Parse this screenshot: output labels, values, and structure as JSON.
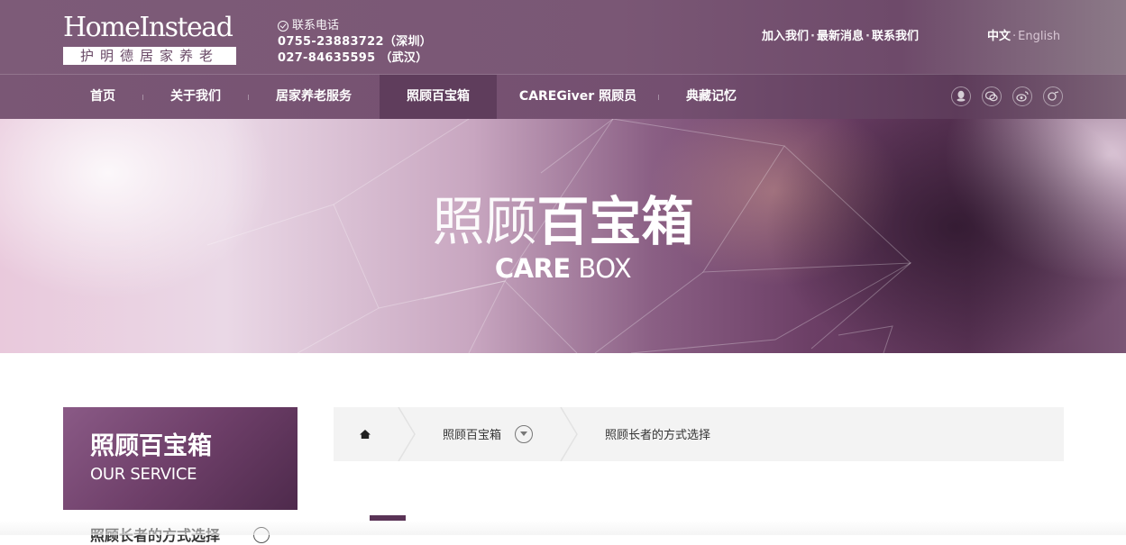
{
  "logo": {
    "main": "HomeInstead",
    "sub": "护明德居家养老"
  },
  "contact": {
    "label": "联系电话",
    "phones": [
      "0755-23883722（深圳）",
      "027-84635595 （武汉）"
    ]
  },
  "top_links": [
    "加入我们",
    "最新消息",
    "联系我们"
  ],
  "language": {
    "current": "中文",
    "other": "English"
  },
  "nav": {
    "items": [
      "首页",
      "关于我们",
      "居家养老服务",
      "照顾百宝箱",
      "CAREGiver 照顾员",
      "典藏记忆"
    ],
    "active_index": 3
  },
  "social_icons": [
    "qq-icon",
    "wechat-icon",
    "weibo-icon",
    "tieba-icon"
  ],
  "banner": {
    "title_light": "照顾",
    "title_bold": "百宝箱",
    "subtitle_bold": "CARE",
    "subtitle_light": "BOX"
  },
  "sidebar": {
    "title_cn": "照顾百宝箱",
    "title_en": "OUR SERVICE",
    "items": [
      {
        "label": "照顾长者的方式选择"
      }
    ]
  },
  "breadcrumb": {
    "section": "照顾百宝箱",
    "current": "照顾长者的方式选择"
  },
  "colors": {
    "brand": "#7a5775",
    "accent": "#5a3356"
  }
}
